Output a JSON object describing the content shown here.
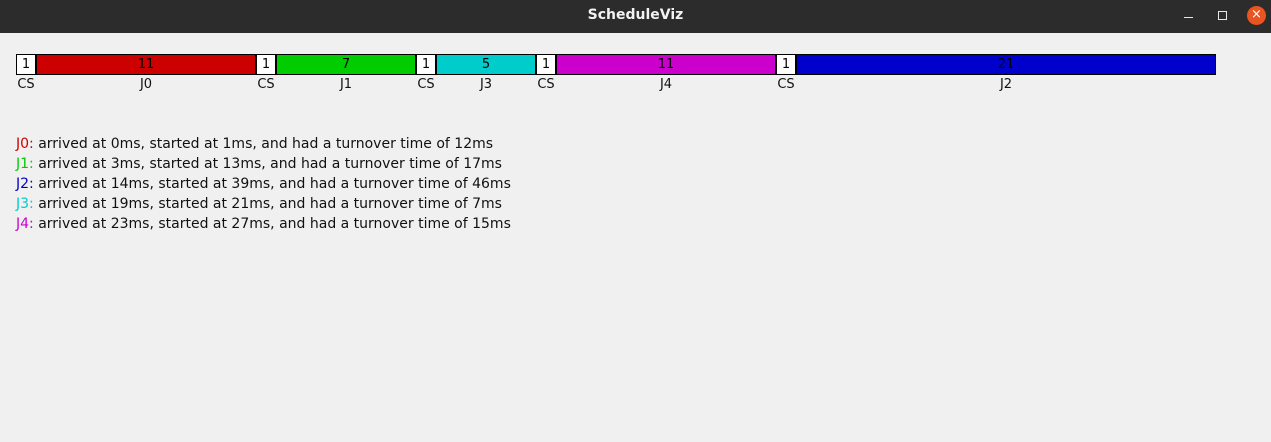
{
  "window": {
    "title": "ScheduleViz",
    "controls": {
      "minimize": "–",
      "maximize": "□",
      "close": "×"
    }
  },
  "colors": {
    "CS": "#ffffff",
    "J0": "#cc0000",
    "J1": "#00cc00",
    "J2": "#0000cc",
    "J3": "#00cccc",
    "J4": "#cc00cc"
  },
  "chart_data": {
    "type": "gantt",
    "units": "ms",
    "segments": [
      {
        "label": "CS",
        "duration": 1,
        "text": "1",
        "color": "#ffffff"
      },
      {
        "label": "J0",
        "duration": 11,
        "text": "11",
        "color": "#cc0000"
      },
      {
        "label": "CS",
        "duration": 1,
        "text": "1",
        "color": "#ffffff"
      },
      {
        "label": "J1",
        "duration": 7,
        "text": "7",
        "color": "#00cc00"
      },
      {
        "label": "CS",
        "duration": 1,
        "text": "1",
        "color": "#ffffff"
      },
      {
        "label": "J3",
        "duration": 5,
        "text": "5",
        "color": "#00cccc"
      },
      {
        "label": "CS",
        "duration": 1,
        "text": "1",
        "color": "#ffffff"
      },
      {
        "label": "J4",
        "duration": 11,
        "text": "11",
        "color": "#cc00cc"
      },
      {
        "label": "CS",
        "duration": 1,
        "text": "1",
        "color": "#ffffff"
      },
      {
        "label": "J2",
        "duration": 21,
        "text": "21",
        "color": "#0000cc"
      }
    ]
  },
  "summary": [
    {
      "job": "J0:",
      "color": "#cc0000",
      "text": " arrived at 0ms, started at 1ms, and had a turnover time of 12ms"
    },
    {
      "job": "J1:",
      "color": "#00cc00",
      "text": " arrived at 3ms, started at 13ms, and had a turnover time of 17ms"
    },
    {
      "job": "J2:",
      "color": "#0000cc",
      "text": " arrived at 14ms, started at 39ms, and had a turnover time of 46ms"
    },
    {
      "job": "J3:",
      "color": "#00cccc",
      "text": " arrived at 19ms, started at 21ms, and had a turnover time of 7ms"
    },
    {
      "job": "J4:",
      "color": "#cc00cc",
      "text": " arrived at 23ms, started at 27ms, and had a turnover time of 15ms"
    }
  ]
}
